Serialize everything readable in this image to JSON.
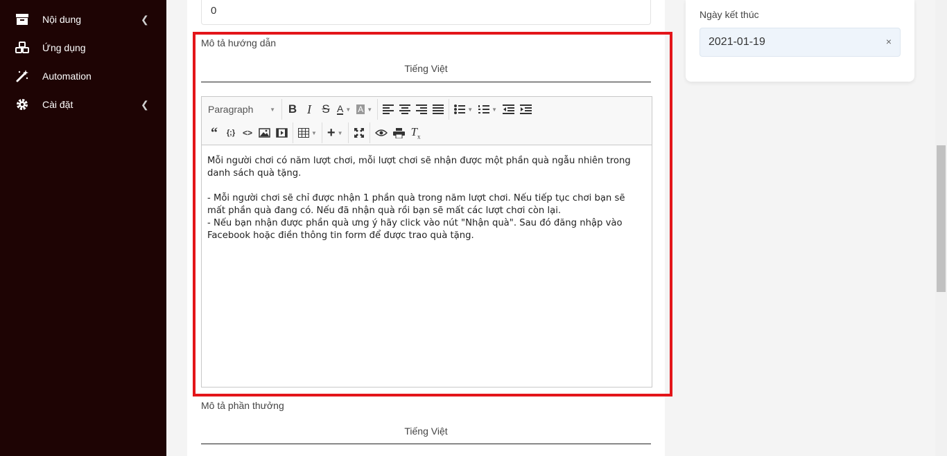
{
  "sidebar": {
    "items": [
      {
        "label": "Nội dung",
        "icon": "archive-icon",
        "has_submenu": true
      },
      {
        "label": "Ứng dụng",
        "icon": "cubes-icon",
        "has_submenu": false
      },
      {
        "label": "Automation",
        "icon": "magic-wand-icon",
        "has_submenu": false
      },
      {
        "label": "Cài đặt",
        "icon": "gear-icon",
        "has_submenu": true
      }
    ]
  },
  "form": {
    "top_input_value": "0",
    "instructions": {
      "label": "Mô tả hướng dẫn",
      "language_tab": "Tiếng Việt",
      "editor": {
        "format_select": "Paragraph",
        "content": [
          "Mỗi người chơi có năm lượt chơi, mỗi lượt chơi sẽ nhận được một phần quà ngẫu nhiên trong danh sách quà tặng.",
          "- Mỗi người chơi sẽ chỉ được nhận 1 phần quà trong năm lượt chơi. Nếu tiếp tục chơi bạn sẽ mất phần quà đang có. Nếu đã nhận quà rồi bạn sẽ mất các lượt chơi còn lại.",
          "- Nếu bạn nhận được phần quà ưng ý hãy click vào nút \"Nhận quà\". Sau đó đăng nhập vào Facebook hoặc điền thông tin form để được trao quà tặng."
        ]
      }
    },
    "reward": {
      "label": "Mô tả phần thưởng",
      "language_tab": "Tiếng Việt"
    }
  },
  "side_panel": {
    "end_date_label": "Ngày kết thúc",
    "end_date_value": "2021-01-19",
    "clear_symbol": "×"
  },
  "colors": {
    "sidebar_bg": "#1e0404",
    "highlight": "#e3151a",
    "date_input_bg": "#eef4fb"
  }
}
